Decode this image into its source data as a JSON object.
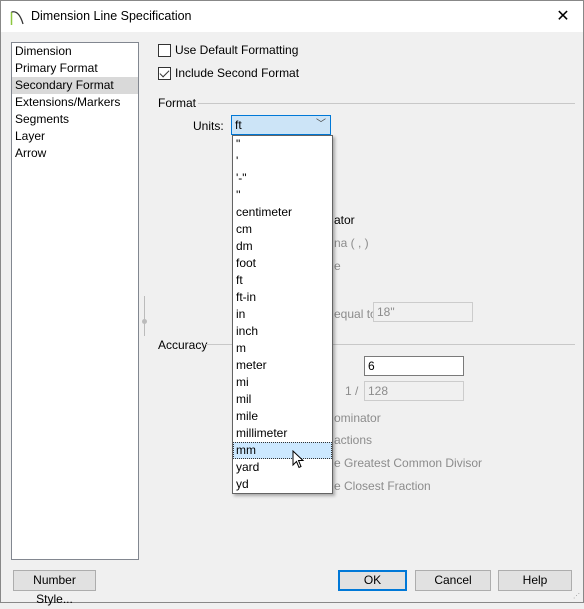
{
  "window": {
    "title": "Dimension Line Specification",
    "close_icon": "close-icon"
  },
  "sidebar": {
    "items": [
      {
        "label": "Dimension"
      },
      {
        "label": "Primary Format"
      },
      {
        "label": "Secondary Format",
        "selected": true
      },
      {
        "label": "Extensions/Markers"
      },
      {
        "label": "Segments"
      },
      {
        "label": "Layer"
      },
      {
        "label": "Arrow"
      }
    ]
  },
  "options": {
    "use_default_formatting": {
      "label": "Use Default Formatting",
      "checked": false
    },
    "include_second_format": {
      "label": "Include Second Format",
      "checked": true
    }
  },
  "format": {
    "group_label": "Format",
    "units_label": "Units:",
    "units_value": "ft",
    "units_options": [
      "\"",
      "'",
      "'-\"",
      "''",
      "centimeter",
      "cm",
      "dm",
      "foot",
      "ft",
      "ft-in",
      "in",
      "inch",
      "m",
      "meter",
      "mi",
      "mil",
      "mile",
      "millimeter",
      "mm",
      "yard",
      "yd"
    ],
    "highlighted_option": "mm",
    "partial_separator": "ator",
    "partial_comma": "na ( , )",
    "partial_e": "e",
    "partial_equal_to": "equal to",
    "equal_to_value": "18\""
  },
  "accuracy": {
    "group_label": "Accuracy",
    "decimal_value": "6",
    "fraction_prefix": "1 /",
    "fraction_value": "128",
    "partial_denominator": "ominator",
    "partial_fractions": "actions",
    "partial_gcd": "e Greatest Common Divisor",
    "partial_closest": "e Closest Fraction"
  },
  "buttons": {
    "number_style": "Number Style...",
    "ok": "OK",
    "cancel": "Cancel",
    "help": "Help"
  }
}
